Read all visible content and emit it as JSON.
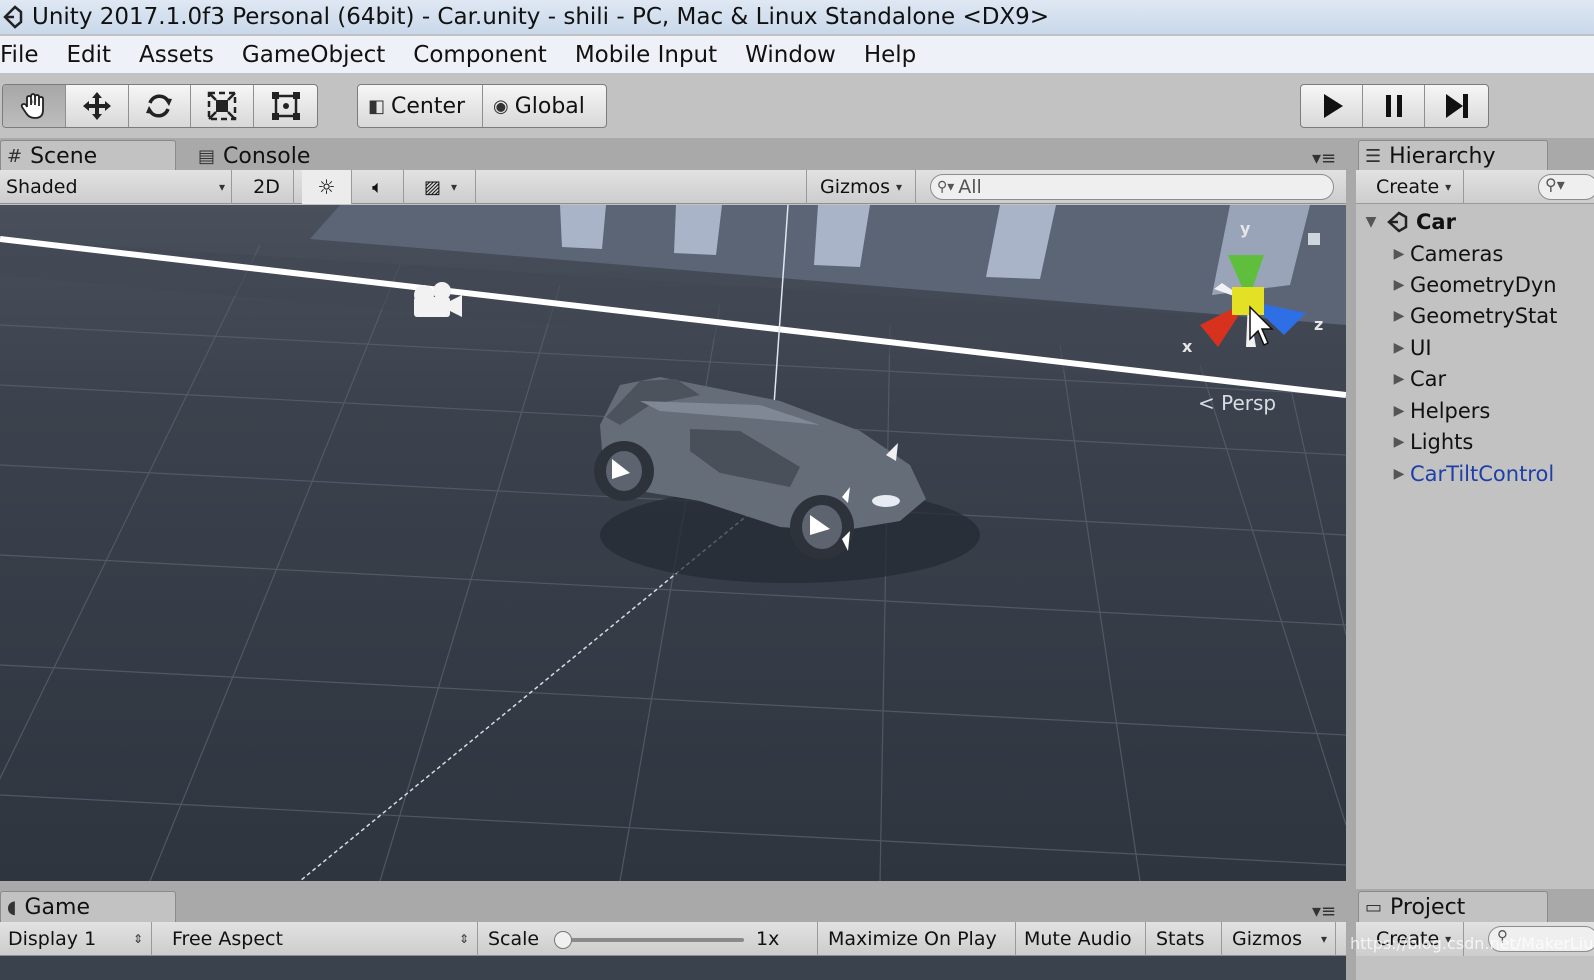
{
  "window": {
    "title": "Unity 2017.1.0f3 Personal (64bit) - Car.unity - shili - PC, Mac & Linux Standalone <DX9>"
  },
  "menu": [
    "File",
    "Edit",
    "Assets",
    "GameObject",
    "Component",
    "Mobile Input",
    "Window",
    "Help"
  ],
  "toolbar": {
    "tools": [
      "hand-tool",
      "move-tool",
      "rotate-tool",
      "scale-tool",
      "rect-tool"
    ],
    "active_tool": "hand-tool",
    "pivot_mode": "Center",
    "pivot_rotation": "Global",
    "playback": [
      "play",
      "pause",
      "step"
    ]
  },
  "scene_tabs": {
    "scene": "Scene",
    "console": "Console"
  },
  "scene_toolbar": {
    "shading": "Shaded",
    "mode_2d": "2D",
    "gizmos": "Gizmos",
    "search_placeholder": "All"
  },
  "scene_view": {
    "projection": "Persp",
    "axes": {
      "x": "x",
      "y": "y",
      "z": "z"
    }
  },
  "hierarchy": {
    "title": "Hierarchy",
    "create": "Create",
    "root": "Car",
    "items": [
      {
        "label": "Cameras",
        "prefab": false
      },
      {
        "label": "GeometryDyn",
        "prefab": false
      },
      {
        "label": "GeometryStat",
        "prefab": false
      },
      {
        "label": "UI",
        "prefab": false
      },
      {
        "label": "Car",
        "prefab": false
      },
      {
        "label": "Helpers",
        "prefab": false
      },
      {
        "label": "Lights",
        "prefab": false
      },
      {
        "label": "CarTiltControl",
        "prefab": true
      }
    ]
  },
  "game": {
    "tab": "Game",
    "display": "Display 1",
    "aspect": "Free Aspect",
    "scale_label": "Scale",
    "scale_value": "1x",
    "maximize": "Maximize On Play",
    "mute": "Mute Audio",
    "stats": "Stats",
    "gizmos": "Gizmos"
  },
  "project": {
    "title": "Project",
    "create": "Create"
  },
  "watermark": "https://blog.csdn.net/MakerLiu"
}
